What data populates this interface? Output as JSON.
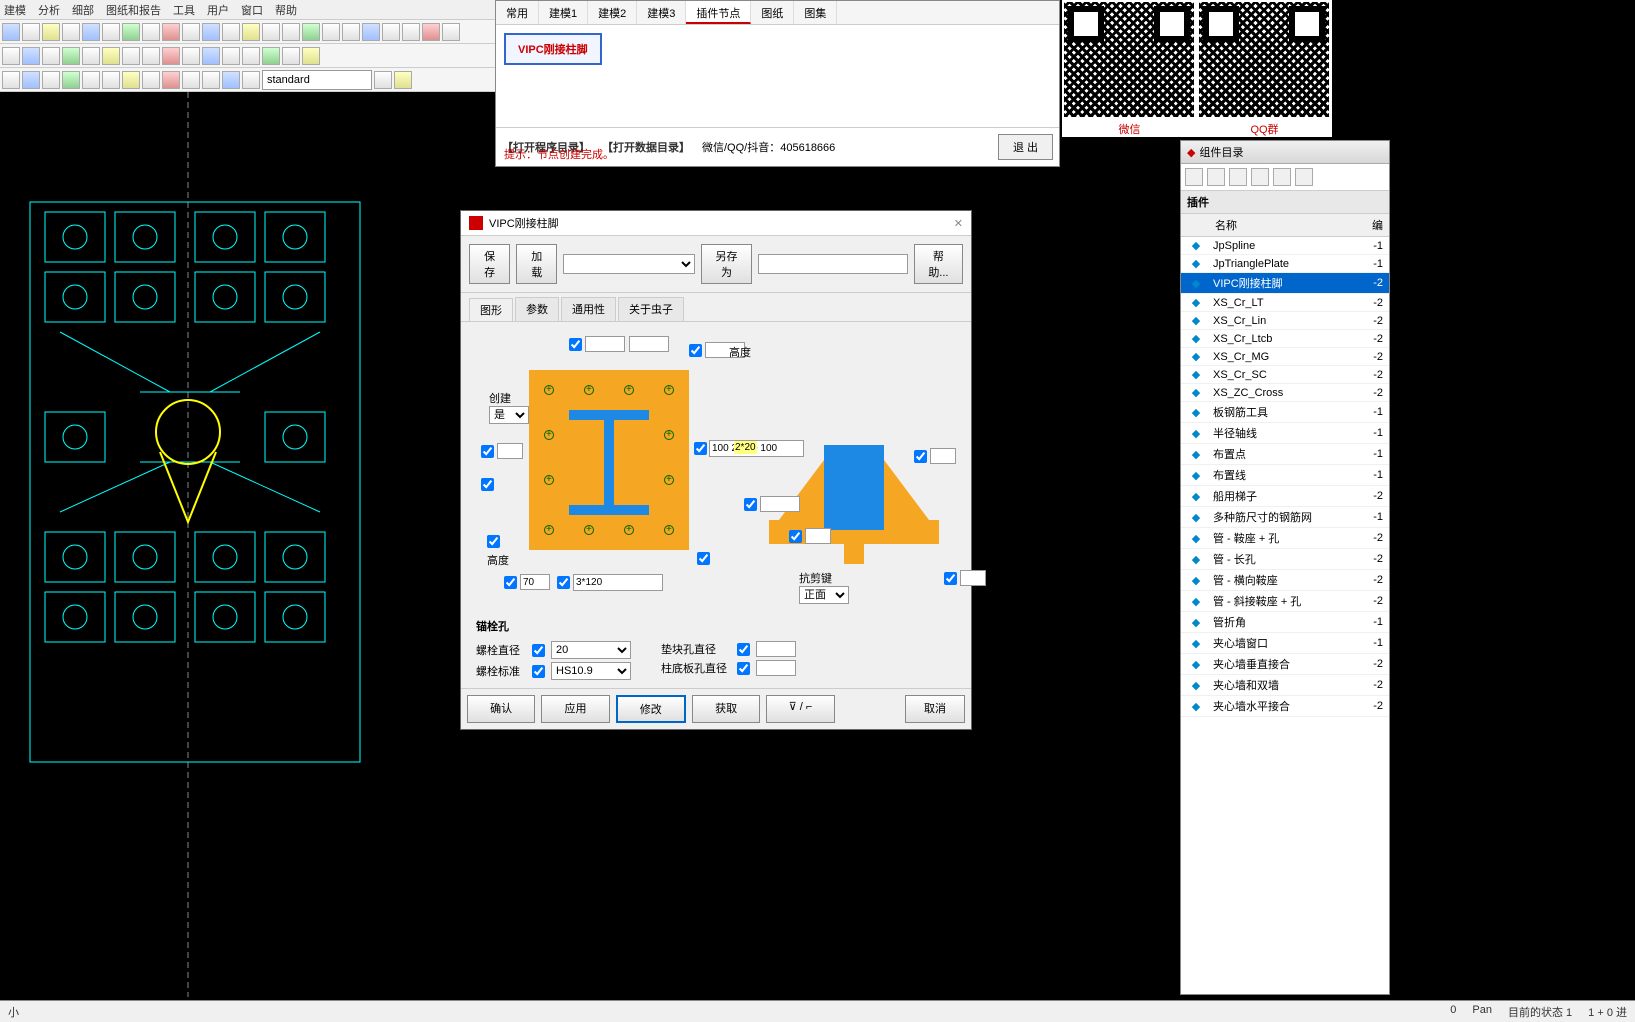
{
  "menu": {
    "items": [
      "建模",
      "分析",
      "细部",
      "图纸和报告",
      "工具",
      "用户",
      "窗口",
      "帮助"
    ]
  },
  "toolbar3": {
    "combo": "standard"
  },
  "plugin": {
    "tabs": [
      "常用",
      "建模1",
      "建模2",
      "建模3",
      "插件节点",
      "图纸",
      "图集"
    ],
    "active": 4,
    "button": "VIPC刚接柱脚",
    "link1": "【打开程序目录】",
    "link2": "【打开数据目录】",
    "qqlabel": "微信/QQ/抖音：405618666",
    "hint": "提示：节点创建完成。",
    "exit": "退 出"
  },
  "qr": {
    "l1": "微信",
    "l2": "QQ群"
  },
  "compcat": {
    "title": "组件目录",
    "section": "插件",
    "hdr": {
      "name": "名称",
      "val": "编"
    },
    "items": [
      {
        "n": "JpSpline",
        "v": "-1"
      },
      {
        "n": "JpTrianglePlate",
        "v": "-1"
      },
      {
        "n": "VIPC刚接柱脚",
        "v": "-2",
        "sel": true
      },
      {
        "n": "XS_Cr_LT",
        "v": "-2"
      },
      {
        "n": "XS_Cr_Lin",
        "v": "-2"
      },
      {
        "n": "XS_Cr_Ltcb",
        "v": "-2"
      },
      {
        "n": "XS_Cr_MG",
        "v": "-2"
      },
      {
        "n": "XS_Cr_SC",
        "v": "-2"
      },
      {
        "n": "XS_ZC_Cross",
        "v": "-2"
      },
      {
        "n": "板钢筋工具",
        "v": "-1"
      },
      {
        "n": "半径轴线",
        "v": "-1"
      },
      {
        "n": "布置点",
        "v": "-1"
      },
      {
        "n": "布置线",
        "v": "-1"
      },
      {
        "n": "船用梯子",
        "v": "-2"
      },
      {
        "n": "多种筋尺寸的钢筋网",
        "v": "-1"
      },
      {
        "n": "管 - 鞍座 + 孔",
        "v": "-2"
      },
      {
        "n": "管 - 长孔",
        "v": "-2"
      },
      {
        "n": "管 - 横向鞍座",
        "v": "-2"
      },
      {
        "n": "管 - 斜接鞍座 + 孔",
        "v": "-2"
      },
      {
        "n": "管折角",
        "v": "-1"
      },
      {
        "n": "夹心墙窗口",
        "v": "-1"
      },
      {
        "n": "夹心墙垂直接合",
        "v": "-2"
      },
      {
        "n": "夹心墙和双墙",
        "v": "-2"
      },
      {
        "n": "夹心墙水平接合",
        "v": "-2"
      }
    ]
  },
  "dialog": {
    "title": "VIPC刚接柱脚",
    "save": "保存",
    "load": "加载",
    "saveas": "另存为",
    "help": "帮助...",
    "tabs": [
      "图形",
      "参数",
      "通用性",
      "关于虫子"
    ],
    "create": "创建",
    "create_val": "是",
    "height": "高度",
    "height2": "高度",
    "dim": {
      "a": "100",
      "b": "2*200",
      "c": "100",
      "d": "70",
      "e": "3*120"
    },
    "shear": "抗剪键",
    "shear_val": "正面",
    "anchor": {
      "title": "锚栓孔",
      "bolt_dia": "螺栓直径",
      "bolt_dia_val": "20",
      "bolt_std": "螺栓标准",
      "bolt_std_val": "HS10.9",
      "pad_dia": "垫块孔直径",
      "base_dia": "柱底板孔直径"
    },
    "buttons": {
      "ok": "确认",
      "apply": "应用",
      "modify": "修改",
      "get": "获取",
      "toggle": "⊽ / ⌐",
      "cancel": "取消"
    }
  },
  "status": {
    "l": "小",
    "pan": "Pan",
    "zero": "0",
    "state": "目前的状态 1",
    "plus": "1 + 0 进"
  }
}
